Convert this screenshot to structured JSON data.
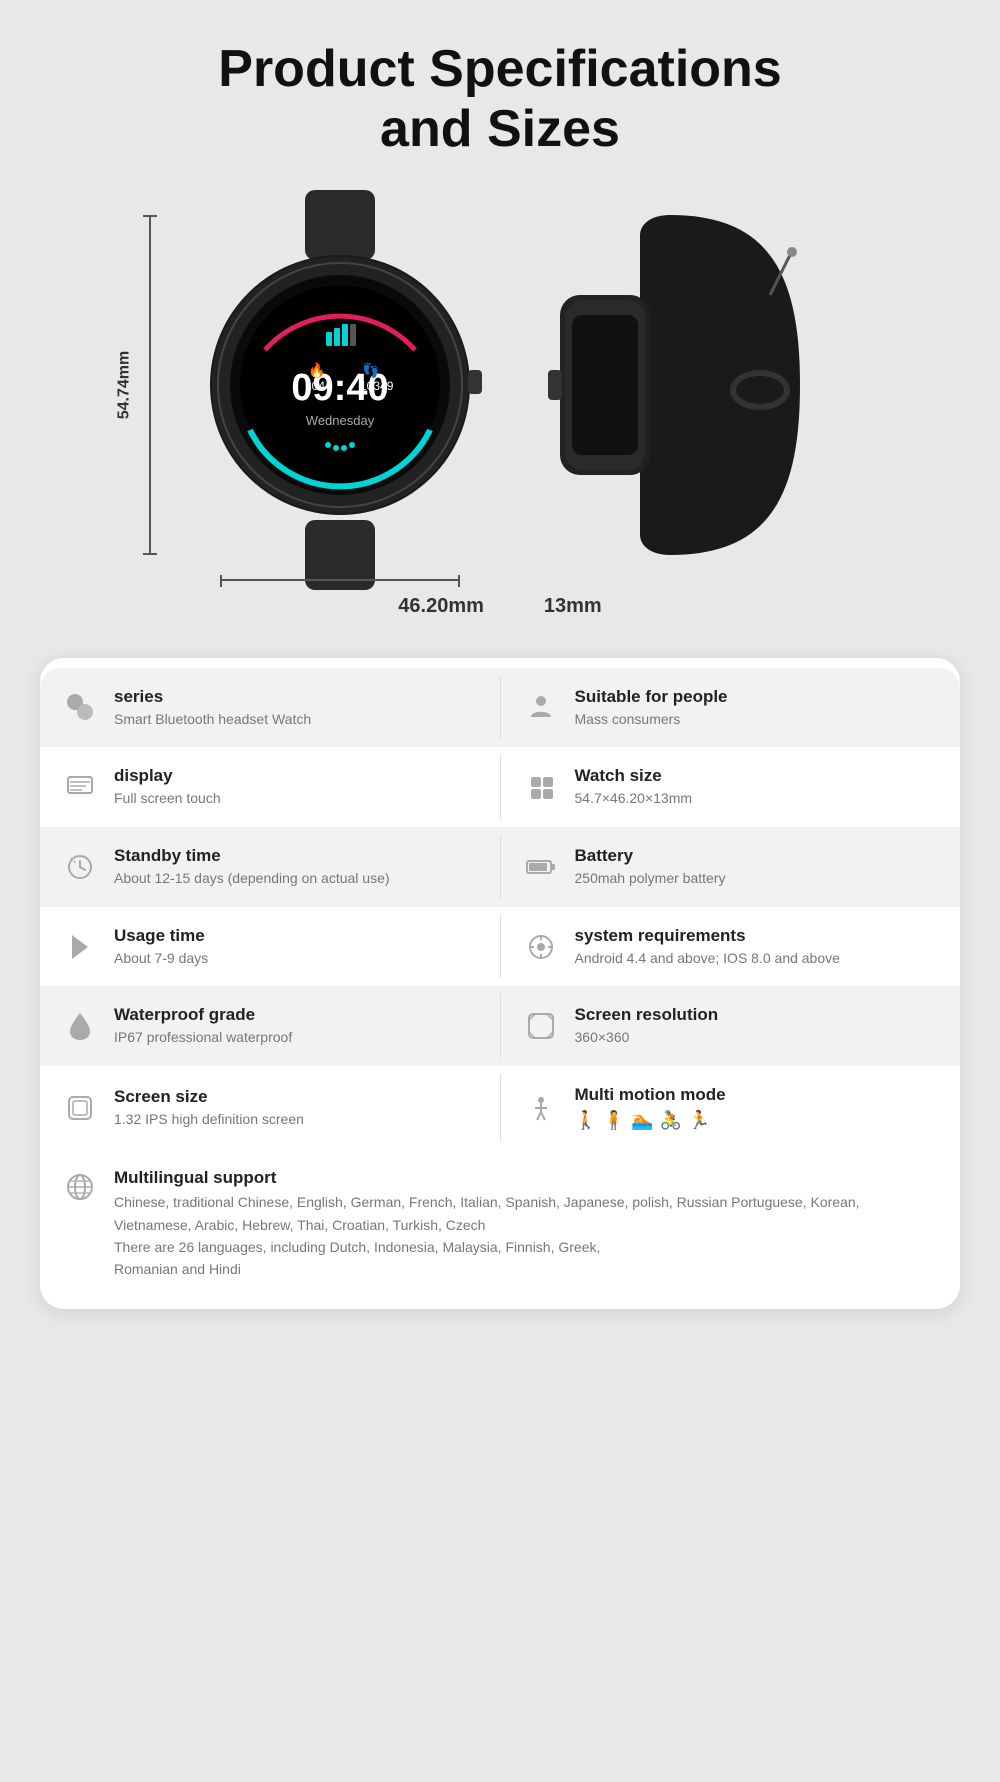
{
  "page": {
    "title": "Product Specifications\nand Sizes"
  },
  "dimensions": {
    "height": "54.74mm",
    "width": "46.20mm",
    "depth": "13mm"
  },
  "specs": [
    {
      "left": {
        "icon": "⬡",
        "title": "series",
        "value": "Smart Bluetooth headset Watch"
      },
      "right": {
        "icon": "👤",
        "title": "Suitable for people",
        "value": "Mass consumers"
      }
    },
    {
      "left": {
        "icon": "☰",
        "title": "display",
        "value": "Full screen touch"
      },
      "right": {
        "icon": "⬛",
        "title": "Watch size",
        "value": "54.7×46.20×13mm"
      }
    },
    {
      "left": {
        "icon": "⏱",
        "title": "Standby time",
        "value": "About 12-15 days (depending on actual use)"
      },
      "right": {
        "icon": "🔋",
        "title": "Battery",
        "value": "250mah polymer battery"
      }
    },
    {
      "left": {
        "icon": "⚡",
        "title": "Usage time",
        "value": "About 7-9 days"
      },
      "right": {
        "icon": "⚙",
        "title": "system requirements",
        "value": "Android 4.4 and above; IOS 8.0 and above"
      }
    },
    {
      "left": {
        "icon": "💧",
        "title": "Waterproof grade",
        "value": "IP67 professional waterproof"
      },
      "right": {
        "icon": "⊞",
        "title": "Screen resolution",
        "value": "360×360"
      }
    },
    {
      "left": {
        "icon": "📱",
        "title": "Screen size",
        "value": "1.32 IPS high definition screen"
      },
      "right": {
        "icon": "🏃",
        "title": "Multi motion mode",
        "value": "motion_icons"
      }
    }
  ],
  "multilingual": {
    "icon": "🌐",
    "title": "Multilingual support",
    "value": "Chinese, traditional Chinese, English, German, French, Italian, Spanish, Japanese, polish, Russian Portuguese, Korean, Vietnamese, Arabic, Hebrew, Thai, Croatian, Turkish, Czech\nThere are 26 languages, including Dutch, Indonesia, Malaysia, Finnish, Greek,\nRomanian and Hindi"
  }
}
